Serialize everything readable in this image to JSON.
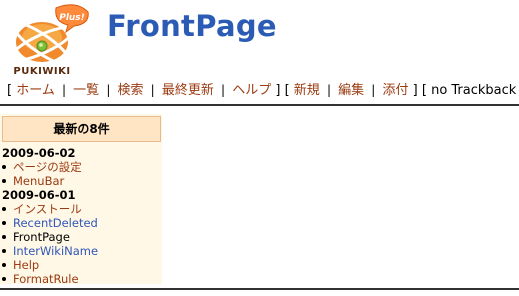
{
  "page": {
    "title": "FrontPage",
    "logo_badge": "Plus!",
    "logo_text": "PUKIWIKI"
  },
  "nav": {
    "home": "ホーム",
    "list": "一覧",
    "search": "検索",
    "recent": "最終更新",
    "help": "ヘルプ",
    "new": "新規",
    "edit": "編集",
    "attach": "添付",
    "trackback": "no Trackback"
  },
  "sidebar": {
    "heading": "最新の8件",
    "groups": [
      {
        "date": "2009-06-02",
        "items": [
          "ページの設定",
          "MenuBar"
        ]
      },
      {
        "date": "2009-06-01",
        "items": [
          "インストール",
          "RecentDeleted",
          "FrontPage",
          "InterWikiName",
          "Help",
          "FormatRule"
        ]
      }
    ]
  },
  "colors": {
    "title": "#2b5bb5",
    "link": "#9b3b12",
    "link_alt": "#2f55b8",
    "sidebar_bg": "#fff8e6",
    "heading_bg": "#ffe5c3"
  }
}
